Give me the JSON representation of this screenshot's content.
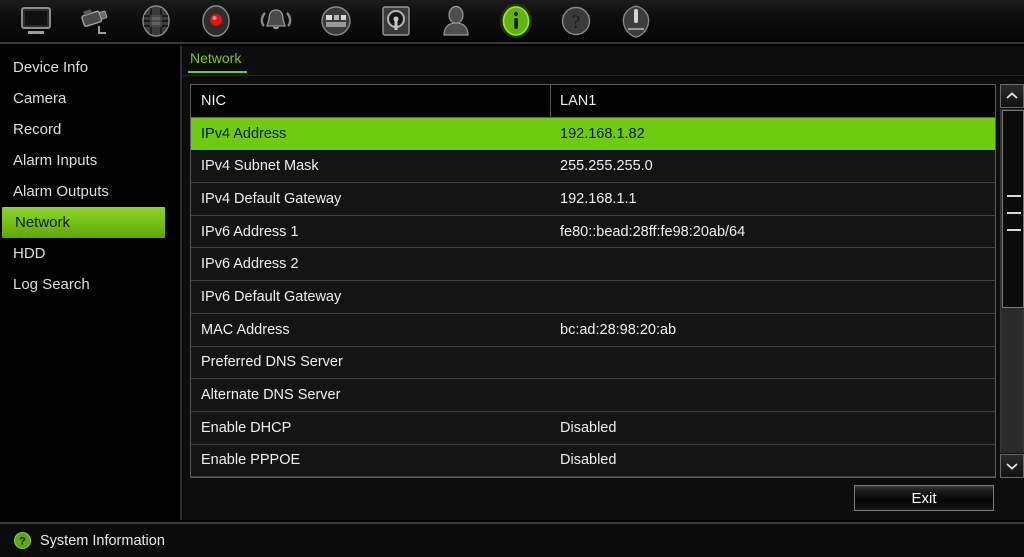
{
  "toolbar": {
    "items": [
      {
        "name": "monitor-icon",
        "label": "Live View"
      },
      {
        "name": "camera-icon",
        "label": "Camera"
      },
      {
        "name": "playback-icon",
        "label": "Playback"
      },
      {
        "name": "record-icon",
        "label": "Record"
      },
      {
        "name": "alarm-icon",
        "label": "Alarm"
      },
      {
        "name": "network-icon",
        "label": "Network"
      },
      {
        "name": "hdd-icon",
        "label": "HDD"
      },
      {
        "name": "user-icon",
        "label": "User"
      },
      {
        "name": "info-icon",
        "label": "System Information"
      },
      {
        "name": "help-icon",
        "label": "Help"
      },
      {
        "name": "power-icon",
        "label": "Shutdown"
      }
    ],
    "active_index": 8
  },
  "sidebar": {
    "items": [
      {
        "label": "Device Info",
        "name": "sidebar-item-device-info"
      },
      {
        "label": "Camera",
        "name": "sidebar-item-camera"
      },
      {
        "label": "Record",
        "name": "sidebar-item-record"
      },
      {
        "label": "Alarm Inputs",
        "name": "sidebar-item-alarm-inputs"
      },
      {
        "label": "Alarm Outputs",
        "name": "sidebar-item-alarm-outputs"
      },
      {
        "label": "Network",
        "name": "sidebar-item-network"
      },
      {
        "label": "HDD",
        "name": "sidebar-item-hdd"
      },
      {
        "label": "Log Search",
        "name": "sidebar-item-log-search"
      }
    ],
    "active_index": 5
  },
  "tabs": {
    "active_label": "Network"
  },
  "table": {
    "header": {
      "key": "NIC",
      "value": "LAN1"
    },
    "selected_index": 0,
    "rows": [
      {
        "key": "IPv4 Address",
        "value": "192.168.1.82"
      },
      {
        "key": "IPv4 Subnet Mask",
        "value": "255.255.255.0"
      },
      {
        "key": "IPv4 Default Gateway",
        "value": "192.168.1.1"
      },
      {
        "key": "IPv6 Address 1",
        "value": "fe80::bead:28ff:fe98:20ab/64"
      },
      {
        "key": "IPv6 Address 2",
        "value": ""
      },
      {
        "key": "IPv6 Default Gateway",
        "value": ""
      },
      {
        "key": "MAC Address",
        "value": "bc:ad:28:98:20:ab"
      },
      {
        "key": "Preferred DNS Server",
        "value": ""
      },
      {
        "key": "Alternate DNS Server",
        "value": ""
      },
      {
        "key": "Enable DHCP",
        "value": "Disabled"
      },
      {
        "key": "Enable PPPOE",
        "value": "Disabled"
      }
    ]
  },
  "scrollbar": {
    "up_glyph": "⌃",
    "down_glyph": "⌄"
  },
  "buttons": {
    "exit_label": "Exit"
  },
  "statusbar": {
    "icon": "question-circle-icon",
    "text": "System Information"
  },
  "colors": {
    "accent_green": "#6ecb10",
    "tab_green": "#7dc620",
    "sidebar_highlight_top": "#8ed42c",
    "sidebar_highlight_bottom": "#5fa50b",
    "panel_bg": "#0d0d0d",
    "row_bg": "#141414"
  }
}
